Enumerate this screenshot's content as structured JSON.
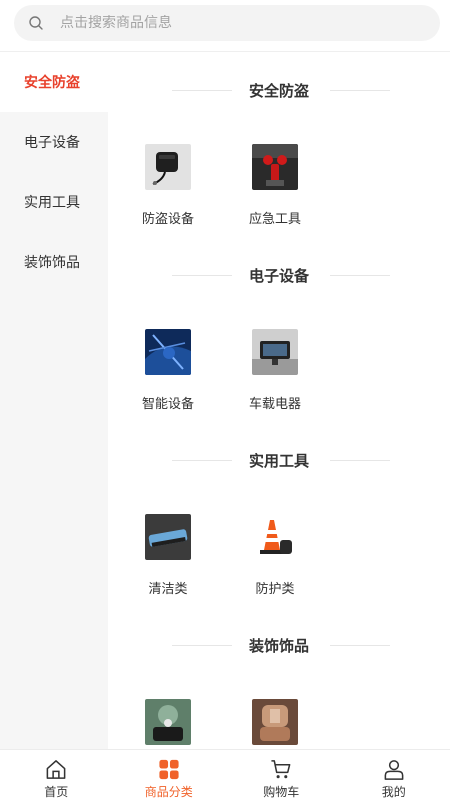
{
  "search": {
    "placeholder": "点击搜索商品信息"
  },
  "sidebar": {
    "items": [
      {
        "label": "安全防盗",
        "active": true
      },
      {
        "label": "电子设备",
        "active": false
      },
      {
        "label": "实用工具",
        "active": false
      },
      {
        "label": "装饰饰品",
        "active": false
      }
    ]
  },
  "sections": [
    {
      "title": "安全防盗",
      "items": [
        {
          "label": "防盗设备",
          "image": "gps-tracker-device"
        },
        {
          "label": "应急工具",
          "image": "emergency-tool"
        }
      ]
    },
    {
      "title": "电子设备",
      "items": [
        {
          "label": "智能设备",
          "image": "smart-device"
        },
        {
          "label": "车载电器",
          "image": "car-electronics"
        }
      ]
    },
    {
      "title": "实用工具",
      "items": [
        {
          "label": "清洁类",
          "image": "cleaning-brush"
        },
        {
          "label": "防护类",
          "image": "safety-cone"
        }
      ]
    },
    {
      "title": "装饰饰品",
      "items": [
        {
          "label": "",
          "image": "dashboard-ornament"
        },
        {
          "label": "",
          "image": "seat-cover"
        }
      ]
    }
  ],
  "tabbar": {
    "tabs": [
      {
        "label": "首页",
        "icon": "home-icon",
        "active": false
      },
      {
        "label": "商品分类",
        "icon": "category-icon",
        "active": true
      },
      {
        "label": "购物车",
        "icon": "cart-icon",
        "active": false
      },
      {
        "label": "我的",
        "icon": "user-icon",
        "active": false
      }
    ]
  },
  "colors": {
    "accent": "#e8412c",
    "tab_active": "#f0622a",
    "sidebar_bg": "#f6f6f6"
  }
}
